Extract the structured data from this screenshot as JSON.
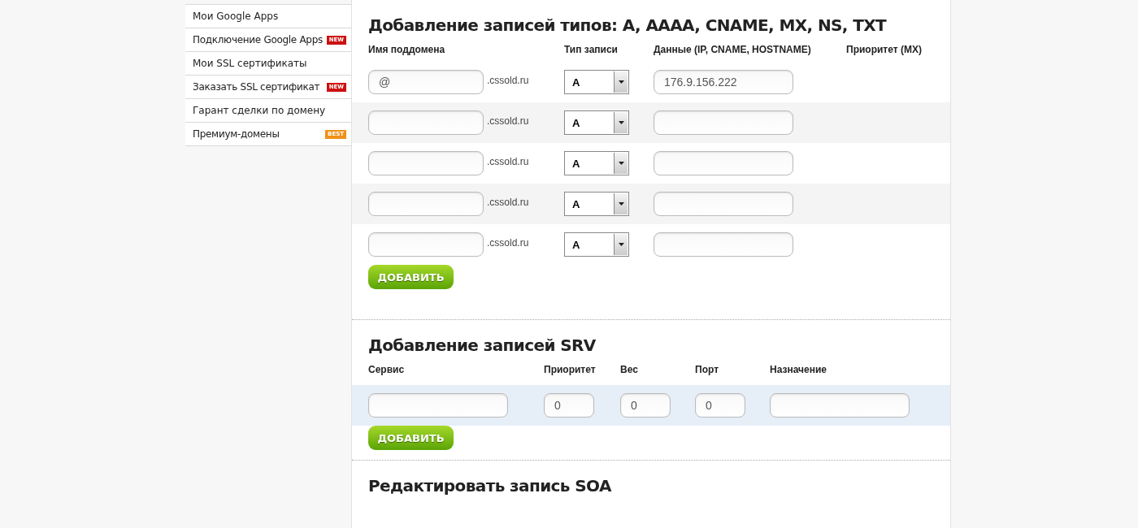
{
  "sidebar": {
    "items": [
      {
        "label": "Мои Google Apps"
      },
      {
        "label": "Подключение Google Apps",
        "badge": {
          "text": "NEW",
          "color": "#cc1111"
        }
      },
      {
        "label": "Мои SSL сертификаты"
      },
      {
        "label": "Заказать SSL сертификат",
        "badge": {
          "text": "NEW",
          "color": "#cc1111"
        }
      },
      {
        "label": "Гарант сделки по домену"
      },
      {
        "label": "Премиум-домены",
        "badge": {
          "text": "BEST",
          "color": "#f09018"
        }
      }
    ]
  },
  "records_section": {
    "title": "Добавление записей типов: A, AAAA, CNAME, MX, NS, TXT",
    "columns": [
      "Имя поддомена",
      "Тип записи",
      "Данные (IP, CNAME, HOSTNAME)",
      "Приоритет (MX)"
    ],
    "rows": [
      {
        "subdomain": "@",
        "suffix": ".cssold.ru",
        "type": "A",
        "data": "176.9.156.222"
      },
      {
        "suffix": ".cssold.ru",
        "type": "A"
      },
      {
        "suffix": ".cssold.ru",
        "type": "A"
      },
      {
        "suffix": ".cssold.ru",
        "type": "A"
      },
      {
        "suffix": ".cssold.ru",
        "type": "A"
      }
    ],
    "button": "ДОБАВИТЬ"
  },
  "srv_section": {
    "title": "Добавление записей SRV",
    "columns": [
      "Сервис",
      "Приоритет",
      "Вес",
      "Порт",
      "Назначение"
    ],
    "row": {
      "priority": "0",
      "weight": "0",
      "port": "0"
    },
    "button": "ДОБАВИТЬ"
  },
  "soa_section": {
    "title": "Редактировать запись SOA"
  }
}
